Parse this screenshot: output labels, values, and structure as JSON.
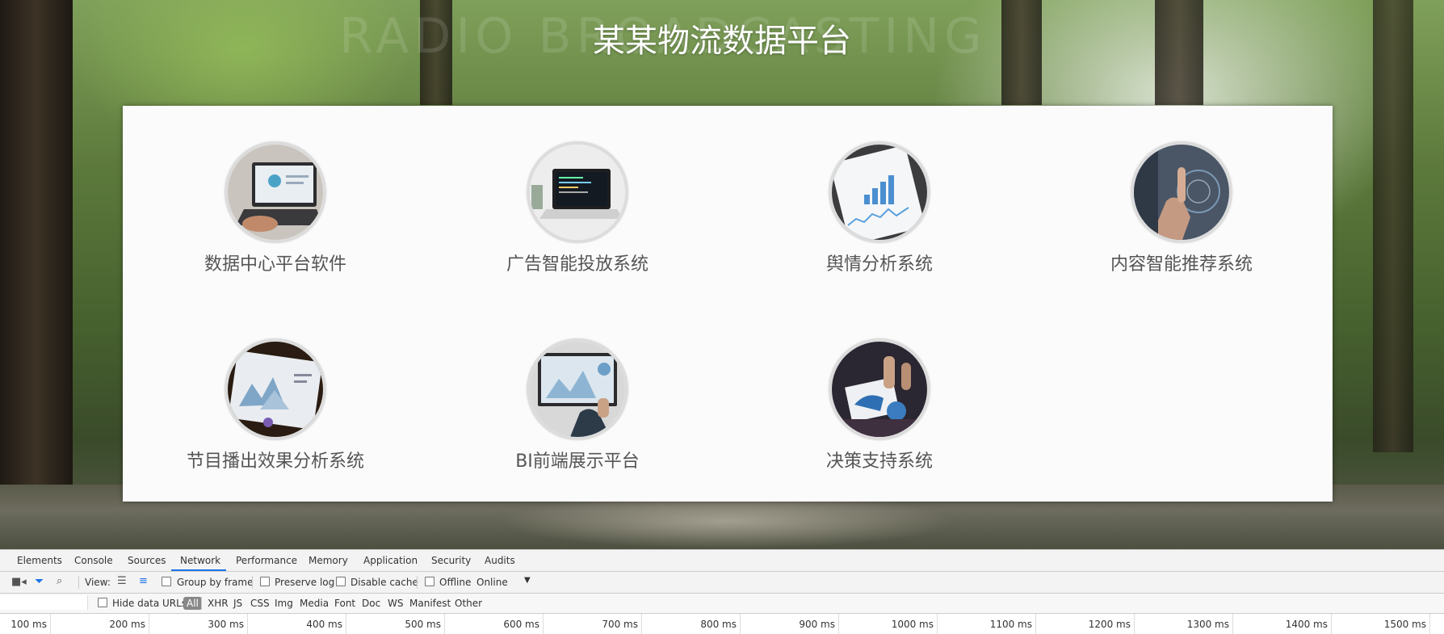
{
  "page": {
    "watermark": "RADIO BROADCASTING",
    "title": "某某物流数据平台"
  },
  "systems": [
    {
      "label": "数据中心平台软件",
      "icon": "laptop-analytics-icon"
    },
    {
      "label": "广告智能投放系统",
      "icon": "laptop-code-icon"
    },
    {
      "label": "舆情分析系统",
      "icon": "tablet-chart-icon"
    },
    {
      "label": "内容智能推荐系统",
      "icon": "touch-interface-icon"
    },
    {
      "label": "节目播出效果分析系统",
      "icon": "dashboard-laptop-icon"
    },
    {
      "label": "BI前端展示平台",
      "icon": "monitor-charts-icon"
    },
    {
      "label": "决策支持系统",
      "icon": "team-reports-icon"
    }
  ],
  "devtools": {
    "tabs": [
      "Elements",
      "Console",
      "Sources",
      "Network",
      "Performance",
      "Memory",
      "Application",
      "Security",
      "Audits"
    ],
    "active_tab": "Network",
    "toolbar": {
      "view_label": "View:",
      "group_by_frame": "Group by frame",
      "preserve_log": "Preserve log",
      "disable_cache": "Disable cache",
      "offline": "Offline",
      "throttling": "Online"
    },
    "filter": {
      "hide_data_urls": "Hide data URLs",
      "types": [
        "All",
        "XHR",
        "JS",
        "CSS",
        "Img",
        "Media",
        "Font",
        "Doc",
        "WS",
        "Manifest",
        "Other"
      ]
    },
    "timeline_ticks": [
      "100 ms",
      "200 ms",
      "300 ms",
      "400 ms",
      "500 ms",
      "600 ms",
      "700 ms",
      "800 ms",
      "900 ms",
      "1000 ms",
      "1100 ms",
      "1200 ms",
      "1300 ms",
      "1400 ms",
      "1500 ms"
    ]
  },
  "colors": {
    "title": "#ffffff",
    "label": "#555555",
    "panel": "#fbfbfb",
    "accent": "#1a73e8"
  }
}
